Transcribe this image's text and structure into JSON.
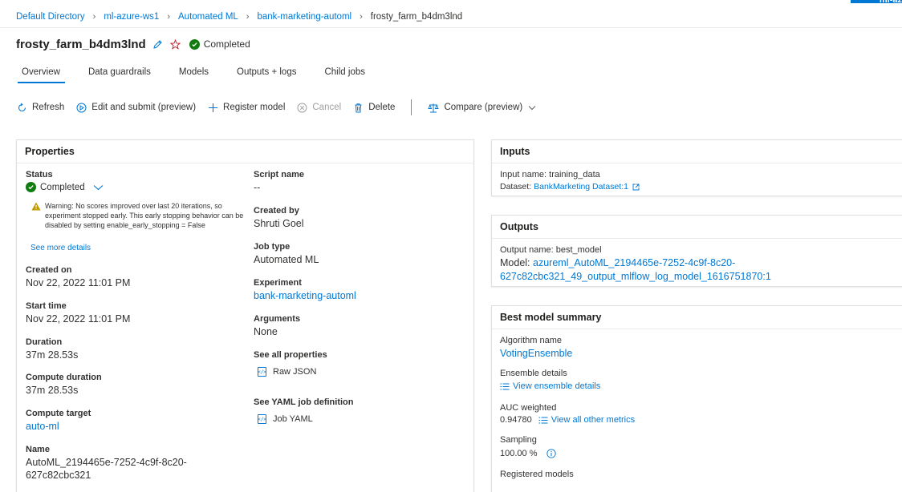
{
  "top_strip": {
    "text": "ml-az"
  },
  "breadcrumb": {
    "items": [
      "Default Directory",
      "ml-azure-ws1",
      "Automated ML",
      "bank-marketing-automl"
    ],
    "current": "frosty_farm_b4dm3lnd"
  },
  "title": {
    "name": "frosty_farm_b4dm3lnd",
    "status": "Completed"
  },
  "tabs": [
    "Overview",
    "Data guardrails",
    "Models",
    "Outputs + logs",
    "Child jobs"
  ],
  "toolbar": {
    "refresh": "Refresh",
    "edit": "Edit and submit (preview)",
    "register": "Register model",
    "cancel": "Cancel",
    "delete": "Delete",
    "compare": "Compare (preview)"
  },
  "properties": {
    "header": "Properties",
    "status_label": "Status",
    "status_value": "Completed",
    "warning": "Warning: No scores improved over last 20 iterations, so experiment stopped early. This early stopping behavior can be disabled by setting enable_early_stopping = False",
    "see_more": "See more details",
    "created_on_label": "Created on",
    "created_on": "Nov 22, 2022 11:01 PM",
    "start_time_label": "Start time",
    "start_time": "Nov 22, 2022 11:01 PM",
    "duration_label": "Duration",
    "duration": "37m 28.53s",
    "compute_duration_label": "Compute duration",
    "compute_duration": "37m 28.53s",
    "compute_target_label": "Compute target",
    "compute_target": "auto-ml",
    "name_label": "Name",
    "name_line1": "AutoML_2194465e-7252-4c9f-8c20-",
    "name_line2": "627c82cbc321",
    "script_name_label": "Script name",
    "script_name": "--",
    "created_by_label": "Created by",
    "created_by": "Shruti Goel",
    "job_type_label": "Job type",
    "job_type": "Automated ML",
    "experiment_label": "Experiment",
    "experiment": "bank-marketing-automl",
    "arguments_label": "Arguments",
    "arguments": "None",
    "see_all_label": "See all properties",
    "raw_json": "Raw JSON",
    "yaml_label": "See YAML job definition",
    "job_yaml": "Job YAML"
  },
  "inputs": {
    "header": "Inputs",
    "input_name": "Input name: training_data",
    "dataset_prefix": "Dataset:",
    "dataset_link": "BankMarketing Dataset:1"
  },
  "outputs": {
    "header": "Outputs",
    "output_name": "Output name: best_model",
    "model_prefix": "Model:",
    "model_line1": "azureml_AutoML_2194465e-7252-4c9f-8c20-",
    "model_line2": "627c82cbc321_49_output_mlflow_log_model_1616751870:1"
  },
  "best_model": {
    "header": "Best model summary",
    "algorithm_label": "Algorithm name",
    "algorithm": "VotingEnsemble",
    "ensemble_label": "Ensemble details",
    "ensemble_link": "View ensemble details",
    "auc_label": "AUC weighted",
    "auc_value": "0.94780",
    "metrics_link": "View all other metrics",
    "sampling_label": "Sampling",
    "sampling_value": "100.00 %",
    "registered_label": "Registered models"
  },
  "colors": {
    "accent": "#0078d4",
    "success": "#107c10",
    "warning": "#c19c00"
  }
}
